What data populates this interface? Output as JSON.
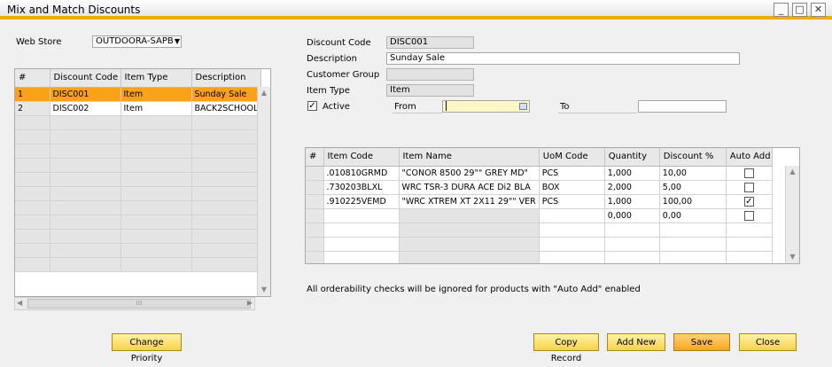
{
  "window": {
    "title": "Mix and Match Discounts",
    "minimize_glyph": "_",
    "maximize_glyph": "□",
    "close_glyph": "✕"
  },
  "web_store": {
    "label": "Web Store",
    "value": "OUTDOORA-SAPB",
    "dropdown_glyph": "▼"
  },
  "discounts_table": {
    "columns": [
      "#",
      "Discount Code",
      "Item Type",
      "Description"
    ],
    "rows": [
      {
        "num": "1",
        "code": "DISC001",
        "type": "Item",
        "desc": "Sunday Sale"
      },
      {
        "num": "2",
        "code": "DISC002",
        "type": "Item",
        "desc": "BACK2SCHOOL"
      }
    ]
  },
  "form": {
    "discount_code_label": "Discount Code",
    "discount_code_value": "DISC001",
    "description_label": "Description",
    "description_value": "Sunday Sale",
    "customer_group_label": "Customer Group",
    "customer_group_value": "",
    "item_type_label": "Item Type",
    "item_type_value": "Item",
    "active_label": "Active",
    "active_checked": true,
    "from_label": "From",
    "from_value": "",
    "to_label": "To",
    "to_value": ""
  },
  "items_table": {
    "columns": [
      "#",
      "Item Code",
      "Item Name",
      "UoM Code",
      "Quantity",
      "Discount %",
      "Auto Add"
    ],
    "rows": [
      {
        "num": "",
        "code": ".010810GRMD",
        "name": "\"CONOR 8500 29\"\" GREY MD\"",
        "uom": "PCS",
        "qty": "1,000",
        "disc": "10,00",
        "auto": false
      },
      {
        "num": "",
        "code": ".730203BLXL",
        "name": "WRC TSR-3 DURA ACE Di2 BLA",
        "uom": "BOX",
        "qty": "2,000",
        "disc": "5,00",
        "auto": false
      },
      {
        "num": "",
        "code": ".910225VEMD",
        "name": "\"WRC XTREM XT 2X11 29\"\" VER",
        "uom": "PCS",
        "qty": "1,000",
        "disc": "100,00",
        "auto": true
      },
      {
        "num": "",
        "code": "",
        "name": "",
        "uom": "",
        "qty": "0,000",
        "disc": "0,00",
        "auto": false
      }
    ]
  },
  "note": "All orderability checks will be ignored for products with \"Auto Add\" enabled",
  "buttons": {
    "change_priority": "Change Priority",
    "copy_record": "Copy Record",
    "add_new": "Add New",
    "save": "Save",
    "close": "Close"
  },
  "icons": {
    "calendar": "calendar-icon",
    "check": "✓",
    "scroll_up": "▲",
    "scroll_down": "▼",
    "scroll_left": "◀",
    "scroll_right": "▶",
    "grip": "⁞⁞⁞"
  }
}
